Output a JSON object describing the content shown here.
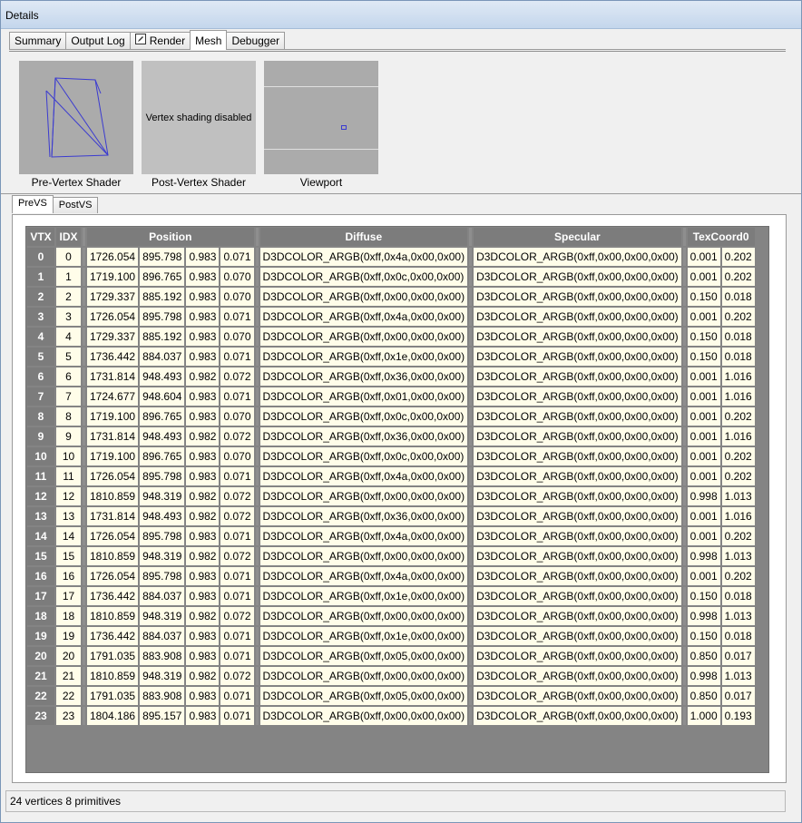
{
  "window": {
    "title": "Details"
  },
  "tabs": [
    {
      "label": "Summary"
    },
    {
      "label": "Output Log"
    },
    {
      "label": "Render",
      "icon": "pencil-icon"
    },
    {
      "label": "Mesh",
      "active": true
    },
    {
      "label": "Debugger"
    }
  ],
  "previews": {
    "pre_vertex_label": "Pre-Vertex Shader",
    "post_vertex_label": "Post-Vertex Shader",
    "post_vertex_text": "Vertex shading disabled",
    "viewport_label": "Viewport"
  },
  "subtabs": [
    {
      "label": "PreVS",
      "active": true
    },
    {
      "label": "PostVS"
    }
  ],
  "table": {
    "headers": [
      "VTX",
      "IDX",
      "Position",
      "Diffuse",
      "Specular",
      "TexCoord0"
    ],
    "rows": [
      [
        "0",
        "0",
        "1726.054",
        "895.798",
        "0.983",
        "0.071",
        "D3DCOLOR_ARGB(0xff,0x4a,0x00,0x00)",
        "D3DCOLOR_ARGB(0xff,0x00,0x00,0x00)",
        "0.001",
        "0.202"
      ],
      [
        "1",
        "1",
        "1719.100",
        "896.765",
        "0.983",
        "0.070",
        "D3DCOLOR_ARGB(0xff,0x0c,0x00,0x00)",
        "D3DCOLOR_ARGB(0xff,0x00,0x00,0x00)",
        "0.001",
        "0.202"
      ],
      [
        "2",
        "2",
        "1729.337",
        "885.192",
        "0.983",
        "0.070",
        "D3DCOLOR_ARGB(0xff,0x00,0x00,0x00)",
        "D3DCOLOR_ARGB(0xff,0x00,0x00,0x00)",
        "0.150",
        "0.018"
      ],
      [
        "3",
        "3",
        "1726.054",
        "895.798",
        "0.983",
        "0.071",
        "D3DCOLOR_ARGB(0xff,0x4a,0x00,0x00)",
        "D3DCOLOR_ARGB(0xff,0x00,0x00,0x00)",
        "0.001",
        "0.202"
      ],
      [
        "4",
        "4",
        "1729.337",
        "885.192",
        "0.983",
        "0.070",
        "D3DCOLOR_ARGB(0xff,0x00,0x00,0x00)",
        "D3DCOLOR_ARGB(0xff,0x00,0x00,0x00)",
        "0.150",
        "0.018"
      ],
      [
        "5",
        "5",
        "1736.442",
        "884.037",
        "0.983",
        "0.071",
        "D3DCOLOR_ARGB(0xff,0x1e,0x00,0x00)",
        "D3DCOLOR_ARGB(0xff,0x00,0x00,0x00)",
        "0.150",
        "0.018"
      ],
      [
        "6",
        "6",
        "1731.814",
        "948.493",
        "0.982",
        "0.072",
        "D3DCOLOR_ARGB(0xff,0x36,0x00,0x00)",
        "D3DCOLOR_ARGB(0xff,0x00,0x00,0x00)",
        "0.001",
        "1.016"
      ],
      [
        "7",
        "7",
        "1724.677",
        "948.604",
        "0.983",
        "0.071",
        "D3DCOLOR_ARGB(0xff,0x01,0x00,0x00)",
        "D3DCOLOR_ARGB(0xff,0x00,0x00,0x00)",
        "0.001",
        "1.016"
      ],
      [
        "8",
        "8",
        "1719.100",
        "896.765",
        "0.983",
        "0.070",
        "D3DCOLOR_ARGB(0xff,0x0c,0x00,0x00)",
        "D3DCOLOR_ARGB(0xff,0x00,0x00,0x00)",
        "0.001",
        "0.202"
      ],
      [
        "9",
        "9",
        "1731.814",
        "948.493",
        "0.982",
        "0.072",
        "D3DCOLOR_ARGB(0xff,0x36,0x00,0x00)",
        "D3DCOLOR_ARGB(0xff,0x00,0x00,0x00)",
        "0.001",
        "1.016"
      ],
      [
        "10",
        "10",
        "1719.100",
        "896.765",
        "0.983",
        "0.070",
        "D3DCOLOR_ARGB(0xff,0x0c,0x00,0x00)",
        "D3DCOLOR_ARGB(0xff,0x00,0x00,0x00)",
        "0.001",
        "0.202"
      ],
      [
        "11",
        "11",
        "1726.054",
        "895.798",
        "0.983",
        "0.071",
        "D3DCOLOR_ARGB(0xff,0x4a,0x00,0x00)",
        "D3DCOLOR_ARGB(0xff,0x00,0x00,0x00)",
        "0.001",
        "0.202"
      ],
      [
        "12",
        "12",
        "1810.859",
        "948.319",
        "0.982",
        "0.072",
        "D3DCOLOR_ARGB(0xff,0x00,0x00,0x00)",
        "D3DCOLOR_ARGB(0xff,0x00,0x00,0x00)",
        "0.998",
        "1.013"
      ],
      [
        "13",
        "13",
        "1731.814",
        "948.493",
        "0.982",
        "0.072",
        "D3DCOLOR_ARGB(0xff,0x36,0x00,0x00)",
        "D3DCOLOR_ARGB(0xff,0x00,0x00,0x00)",
        "0.001",
        "1.016"
      ],
      [
        "14",
        "14",
        "1726.054",
        "895.798",
        "0.983",
        "0.071",
        "D3DCOLOR_ARGB(0xff,0x4a,0x00,0x00)",
        "D3DCOLOR_ARGB(0xff,0x00,0x00,0x00)",
        "0.001",
        "0.202"
      ],
      [
        "15",
        "15",
        "1810.859",
        "948.319",
        "0.982",
        "0.072",
        "D3DCOLOR_ARGB(0xff,0x00,0x00,0x00)",
        "D3DCOLOR_ARGB(0xff,0x00,0x00,0x00)",
        "0.998",
        "1.013"
      ],
      [
        "16",
        "16",
        "1726.054",
        "895.798",
        "0.983",
        "0.071",
        "D3DCOLOR_ARGB(0xff,0x4a,0x00,0x00)",
        "D3DCOLOR_ARGB(0xff,0x00,0x00,0x00)",
        "0.001",
        "0.202"
      ],
      [
        "17",
        "17",
        "1736.442",
        "884.037",
        "0.983",
        "0.071",
        "D3DCOLOR_ARGB(0xff,0x1e,0x00,0x00)",
        "D3DCOLOR_ARGB(0xff,0x00,0x00,0x00)",
        "0.150",
        "0.018"
      ],
      [
        "18",
        "18",
        "1810.859",
        "948.319",
        "0.982",
        "0.072",
        "D3DCOLOR_ARGB(0xff,0x00,0x00,0x00)",
        "D3DCOLOR_ARGB(0xff,0x00,0x00,0x00)",
        "0.998",
        "1.013"
      ],
      [
        "19",
        "19",
        "1736.442",
        "884.037",
        "0.983",
        "0.071",
        "D3DCOLOR_ARGB(0xff,0x1e,0x00,0x00)",
        "D3DCOLOR_ARGB(0xff,0x00,0x00,0x00)",
        "0.150",
        "0.018"
      ],
      [
        "20",
        "20",
        "1791.035",
        "883.908",
        "0.983",
        "0.071",
        "D3DCOLOR_ARGB(0xff,0x05,0x00,0x00)",
        "D3DCOLOR_ARGB(0xff,0x00,0x00,0x00)",
        "0.850",
        "0.017"
      ],
      [
        "21",
        "21",
        "1810.859",
        "948.319",
        "0.982",
        "0.072",
        "D3DCOLOR_ARGB(0xff,0x00,0x00,0x00)",
        "D3DCOLOR_ARGB(0xff,0x00,0x00,0x00)",
        "0.998",
        "1.013"
      ],
      [
        "22",
        "22",
        "1791.035",
        "883.908",
        "0.983",
        "0.071",
        "D3DCOLOR_ARGB(0xff,0x05,0x00,0x00)",
        "D3DCOLOR_ARGB(0xff,0x00,0x00,0x00)",
        "0.850",
        "0.017"
      ],
      [
        "23",
        "23",
        "1804.186",
        "895.157",
        "0.983",
        "0.071",
        "D3DCOLOR_ARGB(0xff,0x00,0x00,0x00)",
        "D3DCOLOR_ARGB(0xff,0x00,0x00,0x00)",
        "1.000",
        "0.193"
      ]
    ]
  },
  "status": {
    "text": "24 vertices  8 primitives"
  },
  "colors": {
    "header_bg": "#7c7c7c",
    "cell_bg": "#fffde9",
    "wireframe": "#3b3bd0"
  }
}
